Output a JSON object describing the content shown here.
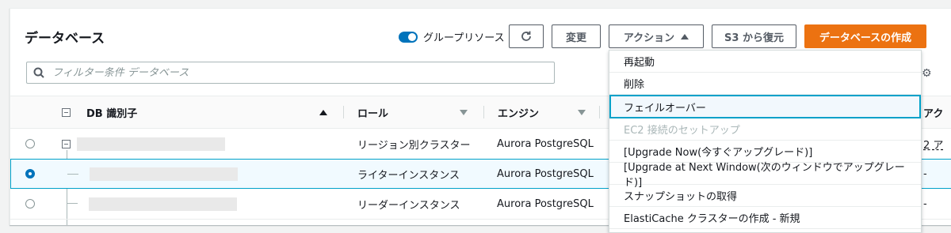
{
  "header": {
    "title": "データベース",
    "group_toggle_label": "グループリソース",
    "modify_label": "変更",
    "actions_label": "アクション",
    "restore_s3_label": "S3 から復元",
    "create_label": "データベースの作成"
  },
  "search": {
    "placeholder": "フィルター条件 データベース"
  },
  "table": {
    "columns": {
      "db_id": "DB 識別子",
      "role": "ロール",
      "engine": "エンジン",
      "next": "アク"
    },
    "rows": [
      {
        "role": "リージョン別クラスター",
        "engine": "Aurora PostgreSQL",
        "trail": "2 ア"
      },
      {
        "role": "ライターインスタンス",
        "engine": "Aurora PostgreSQL",
        "trail": "-"
      },
      {
        "role": "リーダーインスタンス",
        "engine": "Aurora PostgreSQL",
        "trail": "-"
      }
    ]
  },
  "actions_menu": {
    "items": [
      {
        "label": "再起動"
      },
      {
        "label": "削除"
      },
      {
        "label": "フェイルオーバー"
      },
      {
        "label": "EC2 接続のセットアップ"
      },
      {
        "label": "[Upgrade Now(今すぐアップグレード)]"
      },
      {
        "label": "[Upgrade at Next Window(次のウィンドウでアップグレード)]"
      },
      {
        "label": "スナップショットの取得"
      },
      {
        "label": "ElastiCache クラスターの作成 - 新規"
      }
    ]
  },
  "colors": {
    "primary": "#ec7211",
    "accent": "#0073bb",
    "highlight_border": "#00a1c9"
  }
}
